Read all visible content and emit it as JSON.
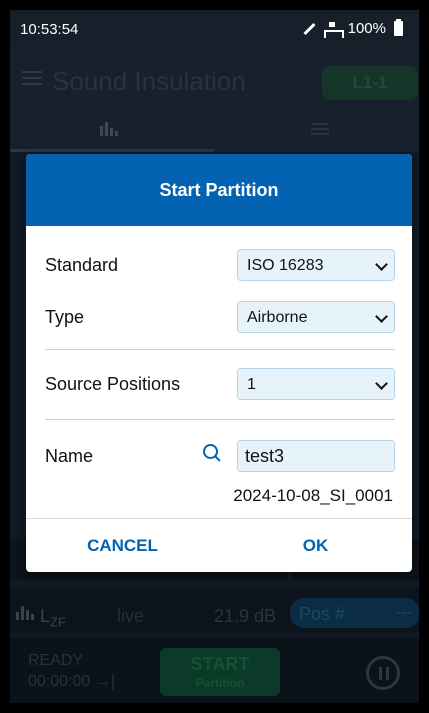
{
  "statusbar": {
    "time": "10:53:54",
    "battery": "100%"
  },
  "appbar": {
    "title": "Sound Insulation",
    "level_badge": "L1-1"
  },
  "background": {
    "meter_label": "L",
    "meter_sub": "ZF",
    "meter_mode": "live",
    "meter_value": "21.9 dB",
    "pos_label": "Pos #",
    "pos_value": "---",
    "status": "READY",
    "timer": "00:00:00 →|",
    "start_label": "START",
    "start_sub": "Partition"
  },
  "dialog": {
    "title": "Start Partition",
    "standard": {
      "label": "Standard",
      "value": "ISO 16283"
    },
    "type": {
      "label": "Type",
      "value": "Airborne"
    },
    "source_positions": {
      "label": "Source Positions",
      "value": "1"
    },
    "name": {
      "label": "Name",
      "value": "test3"
    },
    "file_id": "2024-10-08_SI_0001",
    "cancel_label": "CANCEL",
    "ok_label": "OK"
  },
  "colors": {
    "accent": "#0462b3",
    "field_bg": "#e7f3fb"
  }
}
